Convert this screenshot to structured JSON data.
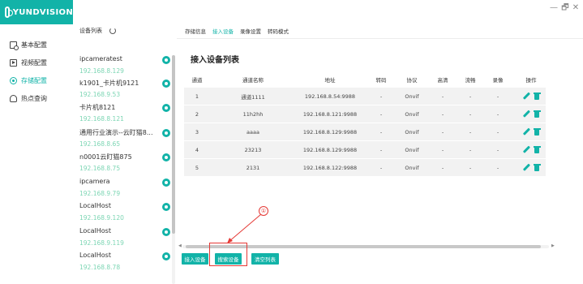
{
  "app": {
    "logo_text": "YUNDVISION"
  },
  "window_controls": {
    "minimize": "—",
    "restore": "🗗",
    "close": "✕"
  },
  "nav": {
    "items": [
      {
        "label": "基本配置",
        "icon": "settings-doc-icon",
        "active": false
      },
      {
        "label": "视频配置",
        "icon": "video-icon",
        "active": false
      },
      {
        "label": "存储配置",
        "icon": "storage-icon",
        "active": true
      },
      {
        "label": "热点查询",
        "icon": "hotspot-icon",
        "active": false
      }
    ]
  },
  "devices": {
    "header": "设备列表",
    "items": [
      {
        "name": "ipcameratest",
        "ip": "192.168.8.129"
      },
      {
        "name": "k1901_卡片机9121",
        "ip": "192.168.9.53"
      },
      {
        "name": "卡片机8121",
        "ip": "192.168.8.121"
      },
      {
        "name": "通用行业演示--云盯猫8...",
        "ip": "192.168.8.65"
      },
      {
        "name": "n0001云盯猫875",
        "ip": "192.168.8.75"
      },
      {
        "name": "ipcamera",
        "ip": "192.168.9.79"
      },
      {
        "name": "LocalHost",
        "ip": "192.168.9.120"
      },
      {
        "name": "LocalHost",
        "ip": "192.168.9.119"
      },
      {
        "name": "LocalHost",
        "ip": "192.168.8.78"
      }
    ]
  },
  "tabs": [
    {
      "label": "存储信息",
      "active": false
    },
    {
      "label": "接入设备",
      "active": true
    },
    {
      "label": "录像设置",
      "active": false
    },
    {
      "label": "转码模式",
      "active": false
    }
  ],
  "section_title": "接入设备列表",
  "table": {
    "columns": [
      "通道",
      "通道名称",
      "地址",
      "转码",
      "协议",
      "高清",
      "流畅",
      "录像",
      "操作"
    ],
    "rows": [
      [
        "1",
        "通道1111",
        "192.168.8.54:9988",
        "-",
        "Onvif",
        "-",
        "-",
        "-"
      ],
      [
        "2",
        "11h2hh",
        "192.168.8.121:9988",
        "-",
        "Onvif",
        "-",
        "-",
        "-"
      ],
      [
        "3",
        "aaaa",
        "192.168.8.129:9988",
        "-",
        "Onvif",
        "-",
        "-",
        "-"
      ],
      [
        "4",
        "23213",
        "192.168.8.129:9988",
        "-",
        "Onvif",
        "-",
        "-",
        "-"
      ],
      [
        "5",
        "2131",
        "192.168.8.122:9988",
        "-",
        "Onvif",
        "-",
        "-",
        "-"
      ]
    ]
  },
  "buttons": {
    "add_device": "接入设备",
    "search_device": "搜索设备",
    "clear_list": "清空列表"
  },
  "annotation": {
    "marker": "①"
  },
  "colors": {
    "accent": "#12b3a8",
    "ip_text": "#7dd6b4",
    "highlight": "#e53935"
  }
}
